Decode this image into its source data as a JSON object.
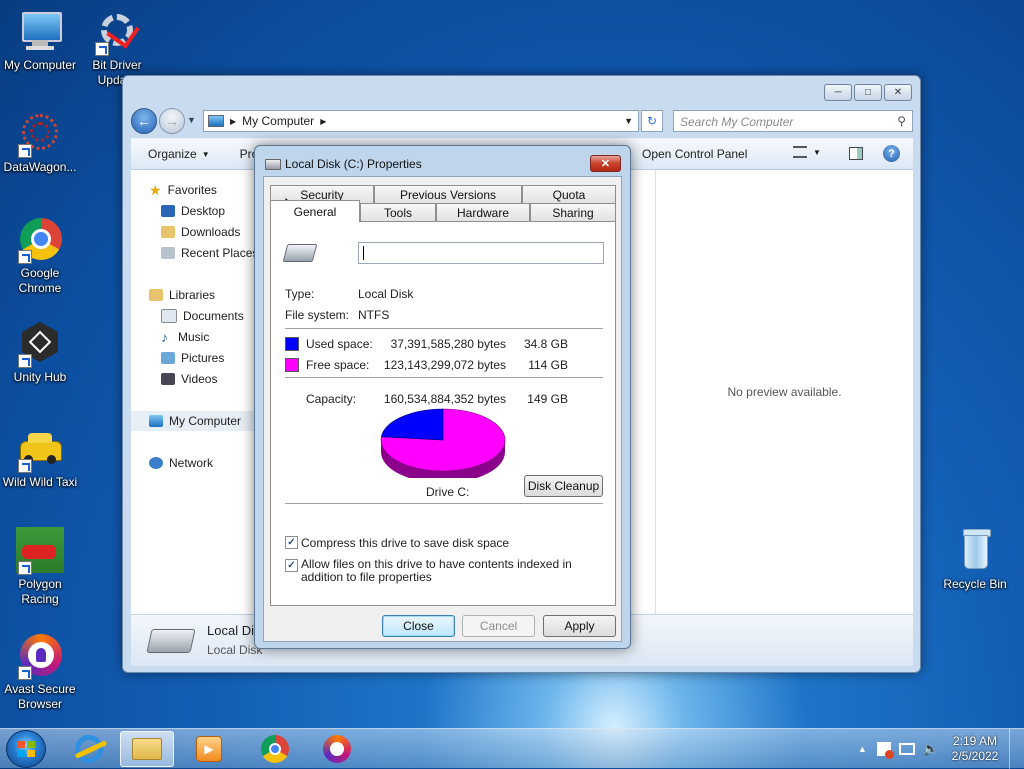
{
  "desktop": {
    "icons": [
      {
        "label": "My Computer"
      },
      {
        "label": "Bit Driver Upda..."
      },
      {
        "label": "DataWagon..."
      },
      {
        "label": "Google Chrome"
      },
      {
        "label": "Unity Hub"
      },
      {
        "label": "Wild Wild Taxi"
      },
      {
        "label": "Polygon Racing"
      },
      {
        "label": "Avast Secure Browser"
      },
      {
        "label": "Recycle Bin"
      }
    ]
  },
  "explorer": {
    "breadcrumb": "My Computer",
    "search_placeholder": "Search My Computer",
    "toolbar": {
      "organize": "Organize",
      "properties_partial": "Pro",
      "open_control_panel": "Open Control Panel"
    },
    "nav": {
      "favorites": "Favorites",
      "desktop": "Desktop",
      "downloads": "Downloads",
      "recent": "Recent Places",
      "libraries": "Libraries",
      "documents": "Documents",
      "music": "Music",
      "pictures": "Pictures",
      "videos": "Videos",
      "my_computer": "My Computer",
      "network": "Network"
    },
    "preview_text": "No preview available.",
    "details": {
      "name": "Local Dis",
      "type": "Local Disk"
    }
  },
  "dialog": {
    "title": "Local Disk (C:) Properties",
    "tabs_back": [
      "Security",
      "Previous Versions",
      "Quota"
    ],
    "tabs_front": [
      "General",
      "Tools",
      "Hardware",
      "Sharing"
    ],
    "active_tab": "General",
    "name_value": "",
    "type_label": "Type:",
    "type_value": "Local Disk",
    "fs_label": "File system:",
    "fs_value": "NTFS",
    "used_label": "Used space:",
    "used_bytes": "37,391,585,280 bytes",
    "used_gb": "34.8 GB",
    "free_label": "Free space:",
    "free_bytes": "123,143,299,072 bytes",
    "free_gb": "114 GB",
    "capacity_label": "Capacity:",
    "capacity_bytes": "160,534,884,352 bytes",
    "capacity_gb": "149 GB",
    "used_fraction": 0.233,
    "used_color": "#0000ff",
    "free_color": "#ff00ff",
    "drive_label": "Drive C:",
    "disk_cleanup": "Disk Cleanup",
    "compress_label": "Compress this drive to save disk space",
    "compress_checked": true,
    "index_label": "Allow files on this drive to have contents indexed in addition to file properties",
    "index_checked": true,
    "buttons": {
      "close": "Close",
      "cancel": "Cancel",
      "apply": "Apply"
    }
  },
  "taskbar": {
    "clock_time": "2:19 AM",
    "clock_date": "2/5/2022"
  }
}
